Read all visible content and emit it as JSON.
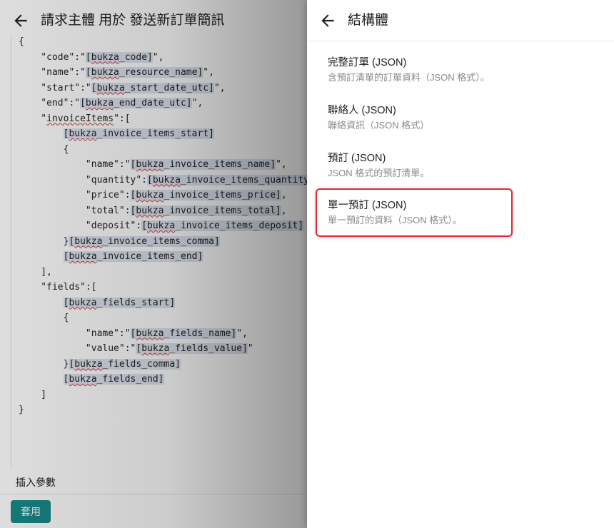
{
  "left_panel": {
    "title": "請求主體 用於 發送新訂單簡訊",
    "code_lines": [
      [
        {
          "t": "{"
        }
      ],
      [
        {
          "t": "    \"code\":\""
        },
        {
          "t": "[bukza_code]",
          "tok": true,
          "sq": "bukza"
        },
        {
          "t": "\","
        }
      ],
      [
        {
          "t": "    \"name\":\""
        },
        {
          "t": "[bukza_resource_name]",
          "tok": true,
          "sq": "bukza"
        },
        {
          "t": "\","
        }
      ],
      [
        {
          "t": "    \"start\":\""
        },
        {
          "t": "[bukza_start_date_utc]",
          "tok": true,
          "sq": "bukza"
        },
        {
          "t": "\","
        }
      ],
      [
        {
          "t": "    \"end\":\""
        },
        {
          "t": "[bukza_end_date_utc]",
          "tok": true,
          "sq": "bukza"
        },
        {
          "t": "\","
        }
      ],
      [
        {
          "t": "    \""
        },
        {
          "t": "invoiceItems",
          "sq": "invoiceItems"
        },
        {
          "t": "\":["
        }
      ],
      [
        {
          "t": "        "
        },
        {
          "t": "[bukza_invoice_items_start]",
          "tok": true,
          "sq": "bukza"
        }
      ],
      [
        {
          "t": "        {"
        }
      ],
      [
        {
          "t": "            \"name\":\""
        },
        {
          "t": "[bukza_invoice_items_name]",
          "tok": true,
          "sq": "bukza"
        },
        {
          "t": "\","
        }
      ],
      [
        {
          "t": "            \"quantity\":"
        },
        {
          "t": "[bukza_invoice_items_quantity]",
          "tok": true,
          "sq": "bukza"
        },
        {
          "t": ","
        }
      ],
      [
        {
          "t": "            \"price\":"
        },
        {
          "t": "[bukza_invoice_items_price]",
          "tok": true,
          "sq": "bukza"
        },
        {
          "t": ","
        }
      ],
      [
        {
          "t": "            \"total\":"
        },
        {
          "t": "[bukza_invoice_items_total]",
          "tok": true,
          "sq": "bukza"
        },
        {
          "t": ","
        }
      ],
      [
        {
          "t": "            \"deposit\":"
        },
        {
          "t": "[bukza_invoice_items_deposit]",
          "tok": true,
          "sq": "bukza"
        }
      ],
      [
        {
          "t": "        }"
        },
        {
          "t": "[bukza_invoice_items_comma]",
          "tok": true,
          "sq": "bukza"
        }
      ],
      [
        {
          "t": "        "
        },
        {
          "t": "[bukza_invoice_items_end]",
          "tok": true,
          "sq": "bukza"
        }
      ],
      [
        {
          "t": "    ],"
        }
      ],
      [
        {
          "t": "    \"fields\":["
        }
      ],
      [
        {
          "t": "        "
        },
        {
          "t": "[bukza_fields_start]",
          "tok": true,
          "sq": "bukza"
        }
      ],
      [
        {
          "t": "        {"
        }
      ],
      [
        {
          "t": "            \"name\":\""
        },
        {
          "t": "[bukza_fields_name]",
          "tok": true,
          "sq": "bukza"
        },
        {
          "t": "\","
        }
      ],
      [
        {
          "t": "            \"value\":\""
        },
        {
          "t": "[bukza_fields_value]",
          "tok": true,
          "sq": "bukza"
        },
        {
          "t": "\""
        }
      ],
      [
        {
          "t": "        }"
        },
        {
          "t": "[bukza_fields_comma]",
          "tok": true,
          "sq": "bukza"
        }
      ],
      [
        {
          "t": "        "
        },
        {
          "t": "[bukza_fields_end]",
          "tok": true,
          "sq": "bukza"
        }
      ],
      [
        {
          "t": "    ]"
        }
      ],
      [
        {
          "t": "}"
        }
      ]
    ],
    "insert_label": "插入參數",
    "apply_label": "套用"
  },
  "drawer": {
    "title": "結構體",
    "options": [
      {
        "title": "完整訂單 (JSON)",
        "desc": "含預訂清單的訂單資料（JSON 格式）。",
        "selected": false
      },
      {
        "title": "聯絡人 (JSON)",
        "desc": "聯絡資訊（JSON 格式）",
        "selected": false
      },
      {
        "title": "預訂 (JSON)",
        "desc": "JSON 格式的預訂清單。",
        "selected": false
      },
      {
        "title": "單一預訂 (JSON)",
        "desc": "單一預訂的資料（JSON 格式）。",
        "selected": true
      }
    ]
  },
  "colors": {
    "accent_teal": "#1a8a8a",
    "selection_border": "#e0282e",
    "token_bg": "#dde3f0",
    "spellcheck": "#d63b3b"
  },
  "icons": {
    "left_back": "arrow-left-icon",
    "drawer_back": "arrow-left-icon"
  }
}
